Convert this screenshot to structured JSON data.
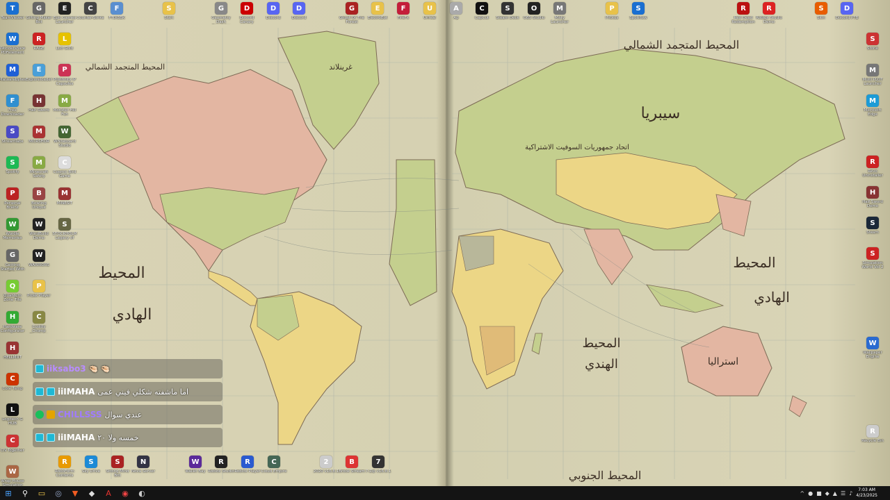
{
  "map_labels": {
    "north_atlantic_top": "المحيط المتجمد الشمالي",
    "north_pacific_left": "المحيط المتجمد الشمالي",
    "left_ocean_1": "المحيط",
    "left_ocean_2": "الهادي",
    "right_ocean_1": "المحيط",
    "right_ocean_2": "الهادي",
    "indian_1": "المحيط",
    "indian_2": "الهندي",
    "south": "المحيط الجنوبي",
    "siberia": "سيبريا",
    "soviet": "اتحاد جمهوريات السوفيت الاشتراكية",
    "greenland": "غرينلاند",
    "australia": "استراليا"
  },
  "top_icons": [
    {
      "label": "TeamViewer",
      "icon": "teamviewer-icon",
      "color": "#1a6fd1"
    },
    {
      "label": "Gifting Maker Bot",
      "icon": "bot-icon",
      "color": "#666"
    },
    {
      "label": "Epic Games Launcher",
      "icon": "epic-icon",
      "color": "#222"
    },
    {
      "label": "Counter-Strike",
      "icon": "cs-icon",
      "color": "#444"
    },
    {
      "label": "FTDI3BK",
      "icon": "app-icon",
      "color": "#5a8fd0"
    },
    {
      "label": "Start",
      "icon": "folder-icon",
      "color": "#e8c24a"
    },
    {
      "label": "Geometry Dash Simulator",
      "icon": "gd-icon",
      "color": "#888"
    },
    {
      "label": "Discord Canary",
      "icon": "app-icon",
      "color": "#c00"
    },
    {
      "label": "Discord",
      "icon": "discord-icon",
      "color": "#5865f2"
    },
    {
      "label": "Discord",
      "icon": "discord-icon",
      "color": "#5865f2"
    },
    {
      "label": "Ghost Of The Forest",
      "icon": "game-icon",
      "color": "#a22"
    },
    {
      "label": "ElectroBot",
      "icon": "folder-icon",
      "color": "#e8c24a"
    },
    {
      "label": "FireFx",
      "icon": "adobe-icon",
      "color": "#c41e3a"
    },
    {
      "label": "Unreal",
      "icon": "folder-icon",
      "color": "#e8c24a"
    },
    {
      "label": "Ap",
      "icon": "app-icon",
      "color": "#aaa"
    },
    {
      "label": "CapCut",
      "icon": "capcut-icon",
      "color": "#111"
    },
    {
      "label": "Steam Deck",
      "icon": "app-icon",
      "color": "#333"
    },
    {
      "label": "OBS Studio",
      "icon": "obs-icon",
      "color": "#222"
    },
    {
      "label": "Misty Launcher",
      "icon": "app-icon",
      "color": "#777"
    },
    {
      "label": "Photos",
      "icon": "folder-icon",
      "color": "#e8c24a"
    },
    {
      "label": "Spotiflow",
      "icon": "app-icon",
      "color": "#1a6fd1"
    },
    {
      "label": "Red Dead Redemption",
      "icon": "rdr-icon",
      "color": "#b11"
    },
    {
      "label": "Roblox Studio Demo",
      "icon": "app-icon",
      "color": "#d22"
    },
    {
      "label": "Skin",
      "icon": "app-icon",
      "color": "#e85d00"
    },
    {
      "label": "Discord PTB",
      "icon": "discord-icon",
      "color": "#5865f2"
    }
  ],
  "left_col1": [
    {
      "label": "Wondershare PDFelement",
      "icon": "pdf-icon",
      "color": "#1a6fd1"
    },
    {
      "label": "Malwarebytes",
      "icon": "malware-icon",
      "color": "#1f5fd6"
    },
    {
      "label": "Free Downloader",
      "icon": "download-icon",
      "color": "#2f8fd0"
    },
    {
      "label": "Streamlabs",
      "icon": "app-icon",
      "color": "#4a4ac4"
    },
    {
      "label": "Spotify",
      "icon": "spotify-icon",
      "color": "#1db954"
    },
    {
      "label": "Personal Brainz",
      "icon": "app-icon",
      "color": "#b22"
    },
    {
      "label": "Wordle Memories",
      "icon": "app-icon",
      "color": "#393"
    },
    {
      "label": "Getting Started With Bots",
      "icon": "app-icon",
      "color": "#666"
    },
    {
      "label": "Quantum Zone Tile",
      "icon": "app-icon",
      "color": "#7c3"
    },
    {
      "label": "Hardware Configurator",
      "icon": "app-icon",
      "color": "#3a3"
    },
    {
      "label": "HELLMUT",
      "icon": "app-icon",
      "color": "#933"
    },
    {
      "label": "Core Temp",
      "icon": "app-icon",
      "color": "#c30"
    },
    {
      "label": "Logitech G HUB",
      "icon": "logitech-icon",
      "color": "#111"
    },
    {
      "label": "CN Together",
      "icon": "app-icon",
      "color": "#c33"
    },
    {
      "label": "Wrap House Simulation",
      "icon": "app-icon",
      "color": "#a64"
    }
  ],
  "left_col2": [
    {
      "label": "RAGE",
      "icon": "app-icon",
      "color": "#c22"
    },
    {
      "label": "Exploreloader",
      "icon": "app-icon",
      "color": "#4a9fd8"
    },
    {
      "label": "Half Sword",
      "icon": "app-icon",
      "color": "#733"
    },
    {
      "label": "MICRSHOR",
      "icon": "app-icon",
      "color": "#a33"
    },
    {
      "label": "Minecraft Safety",
      "icon": "app-icon",
      "color": "#8a4"
    },
    {
      "label": "Bowling Unique",
      "icon": "app-icon",
      "color": "#944"
    },
    {
      "label": "WindBuild Demo",
      "icon": "app-icon",
      "color": "#222"
    },
    {
      "label": "WARRIORS",
      "icon": "app-icon",
      "color": "#222"
    },
    {
      "label": "Prosk Player",
      "icon": "app-icon",
      "color": "#e8c24a"
    },
    {
      "label": "Cuddly Chomp Blumberg",
      "icon": "app-icon",
      "color": "#884"
    }
  ],
  "left_col3": [
    {
      "label": "Luo Gold",
      "icon": "app-icon",
      "color": "#e6c200"
    },
    {
      "label": "Phinfinity IP Capsules",
      "icon": "app-icon",
      "color": "#c35"
    },
    {
      "label": "Monster Hill Fun",
      "icon": "app-icon",
      "color": "#8a4"
    },
    {
      "label": "Whiteboard Studio",
      "icon": "app-icon",
      "color": "#463"
    },
    {
      "label": "Cosmic Bird Game",
      "icon": "app-icon",
      "color": "#ddd"
    },
    {
      "label": "MINESIT",
      "icon": "app-icon",
      "color": "#933"
    },
    {
      "label": "STOCKHOLM Legacy of",
      "icon": "app-icon",
      "color": "#664"
    }
  ],
  "right_icons": [
    {
      "label": "Stone",
      "icon": "app-icon",
      "color": "#c33"
    },
    {
      "label": "Multi PLOT Launcher",
      "icon": "app-icon",
      "color": "#777"
    },
    {
      "label": "Microsoft Edge",
      "icon": "edge-icon",
      "color": "#1c9bd6"
    },
    {
      "label": "Revo Uninstaller",
      "icon": "app-icon",
      "color": "#c22"
    },
    {
      "label": "Half Sword Demo",
      "icon": "app-icon",
      "color": "#833"
    },
    {
      "label": "Steam",
      "icon": "steam-icon",
      "color": "#1b2838"
    },
    {
      "label": "Simulation World Vol 2",
      "icon": "app-icon",
      "color": "#c22"
    },
    {
      "label": "Wallpaper Engine",
      "icon": "app-icon",
      "color": "#2a6ad0"
    },
    {
      "label": "Recycle Bin",
      "icon": "recycle-icon",
      "color": "#ccc"
    }
  ],
  "bottom_icons": [
    {
      "label": "RoboForm Contents",
      "icon": "app-icon",
      "color": "#e89a00"
    },
    {
      "label": "Sky Drive",
      "icon": "app-icon",
      "color": "#1c8ad6"
    },
    {
      "label": "Strong Mind Bot",
      "icon": "app-icon",
      "color": "#a22"
    },
    {
      "label": "Nova Server",
      "icon": "app-icon",
      "color": "#334"
    },
    {
      "label": "Wallet Bay",
      "icon": "app-icon",
      "color": "#5b2a9a"
    },
    {
      "label": "Roblox Studio",
      "icon": "roblox-icon",
      "color": "#222"
    },
    {
      "label": "Roblox Player",
      "icon": "roblox-icon",
      "color": "#2a5ad0"
    },
    {
      "label": "Cloud Empire",
      "icon": "app-icon",
      "color": "#465"
    },
    {
      "label": "2020 v16.8.1",
      "icon": "file-icon",
      "color": "#ccc"
    },
    {
      "label": "Brook Stream",
      "icon": "app-icon",
      "color": "#d33"
    },
    {
      "label": "7-Zip v16.8.1",
      "icon": "zip-icon",
      "color": "#333"
    }
  ],
  "chat": [
    {
      "user": "iiksabo3",
      "user_color": "#b88cff",
      "message": "🤏🏻 🤏🏻",
      "badges": [
        "cyan"
      ]
    },
    {
      "user": "iiIMAHA",
      "user_color": "#ffffff",
      "message": "اما ماشفته شكلي فيني عمى",
      "badges": [
        "cyan",
        "cyan"
      ]
    },
    {
      "user": "CHILLSSS",
      "user_color": "#a07bff",
      "message": "عندي سوال",
      "badges": [
        "grn",
        "gold"
      ]
    },
    {
      "user": "iiIMAHA",
      "user_color": "#ffffff",
      "message": "خمسه ولا ٢٠",
      "badges": [
        "cyan",
        "cyan"
      ]
    }
  ],
  "taskbar": {
    "time": "7:03 AM",
    "date": "4/23/2025",
    "apps": [
      "start-icon",
      "search-icon",
      "file-explorer-icon",
      "steam-icon",
      "brave-icon",
      "roblox-icon",
      "adobe-icon",
      "chrome-icon",
      "obs-icon"
    ]
  }
}
